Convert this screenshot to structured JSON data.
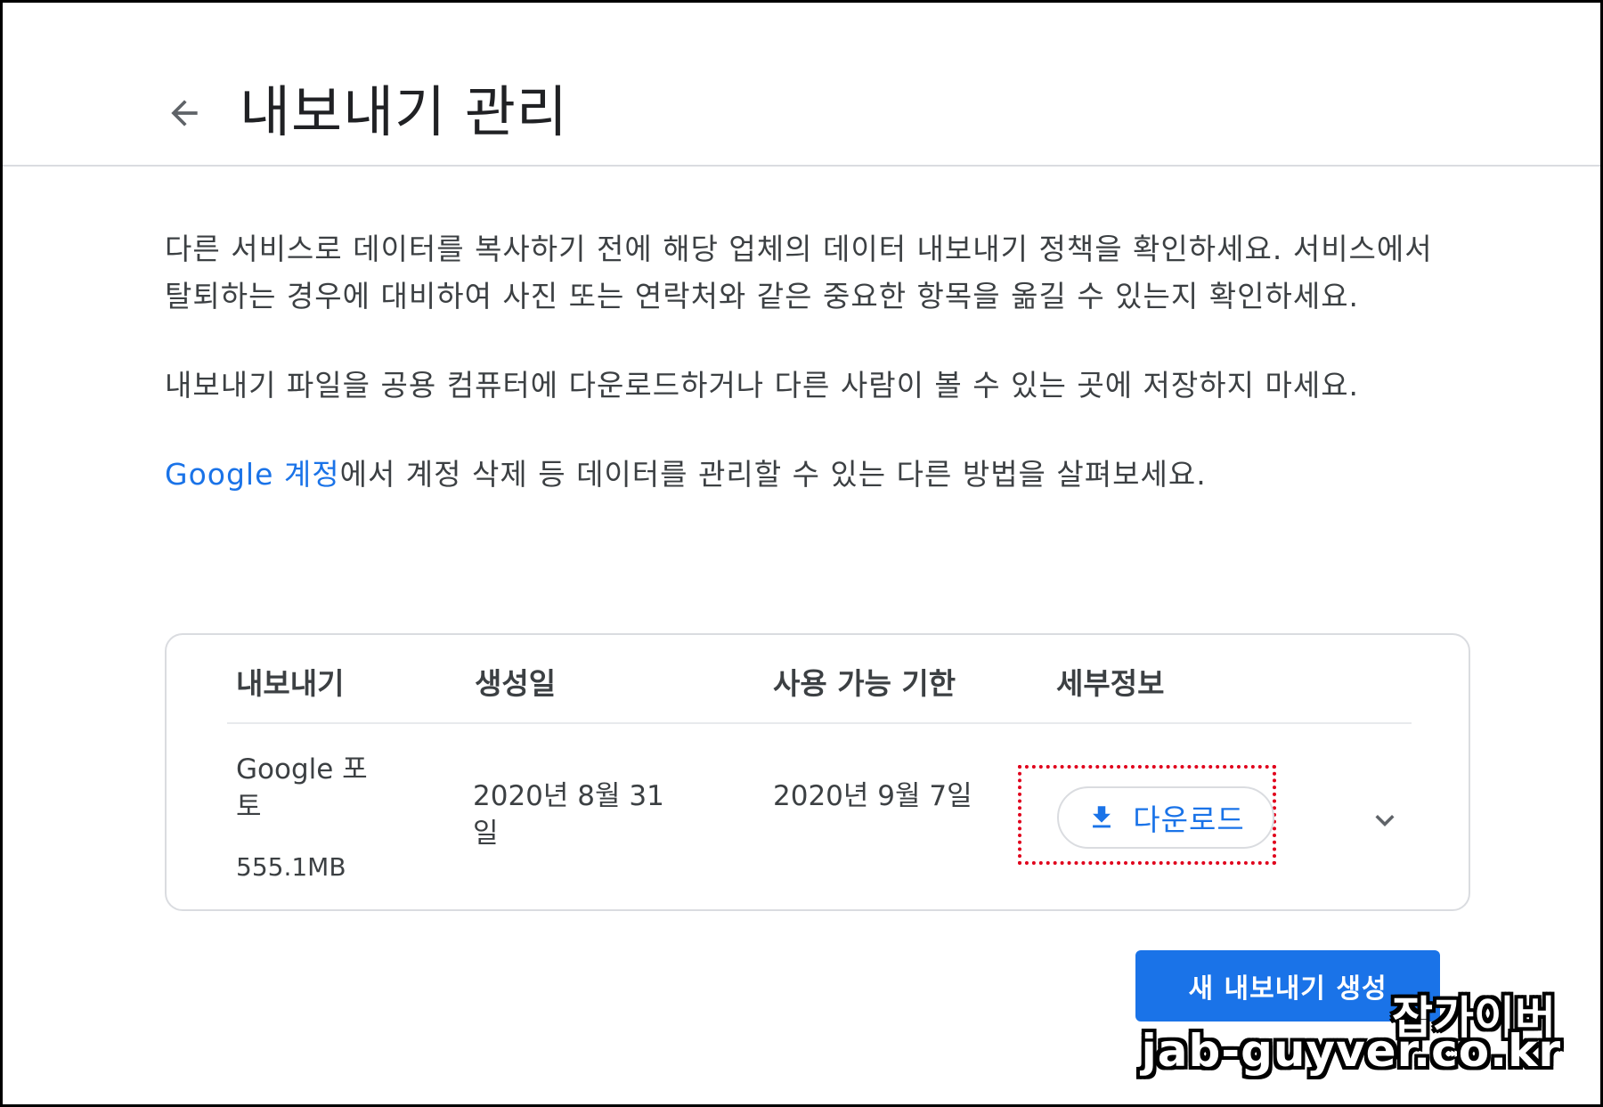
{
  "header": {
    "back_icon": "arrow-left-icon",
    "title": "내보내기 관리"
  },
  "content": {
    "paragraph_1": "다른 서비스로 데이터를 복사하기 전에 해당 업체의 데이터 내보내기 정책을 확인하세요. 서비스에서 탈퇴하는 경우에 대비하여 사진 또는 연락처와 같은 중요한 항목을 옮길 수 있는지 확인하세요.",
    "paragraph_2": "내보내기 파일을 공용 컴퓨터에 다운로드하거나 다른 사람이 볼 수 있는 곳에 저장하지 마세요.",
    "paragraph_3_link": "Google 계정",
    "paragraph_3_rest": "에서 계정 삭제 등 데이터를 관리할 수 있는 다른 방법을 살펴보세요."
  },
  "table": {
    "headers": [
      "내보내기",
      "생성일",
      "사용 가능 기한",
      "세부정보"
    ],
    "rows": [
      {
        "name": "Google 포토",
        "size": "555.1MB",
        "created": "2020년 8월 31일",
        "expires": "2020년 9월 7일",
        "download_label": "다운로드",
        "download_icon": "download-icon",
        "expand_icon": "chevron-down-icon"
      }
    ]
  },
  "actions": {
    "create_label": "새 내보내기 생성"
  },
  "watermark": {
    "line_1": "잡가이버",
    "line_2": "jab-guyver.co.kr"
  },
  "colors": {
    "accent": "#1a73e8",
    "highlight": "#e0001b",
    "text": "#3c4043",
    "border": "#dadce0"
  }
}
